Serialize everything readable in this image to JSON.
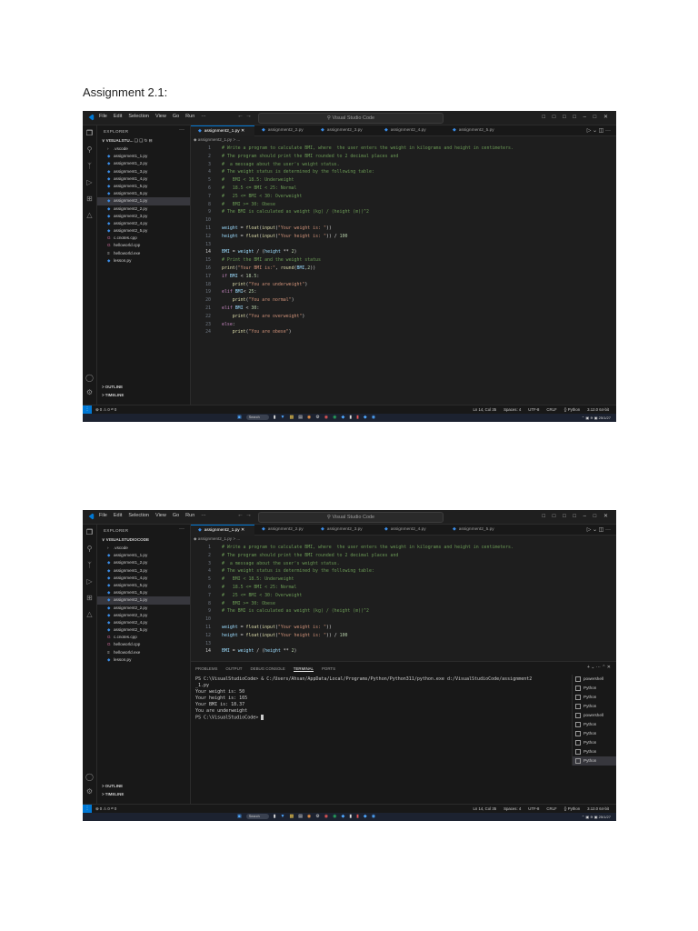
{
  "document": {
    "heading": "Assignment 2.1:"
  },
  "app": {
    "menu": [
      "File",
      "Edit",
      "Selection",
      "View",
      "Go",
      "Run",
      "···"
    ],
    "search": "Visual Studio Code",
    "window_controls": "□ □ □ □   – □ ✕"
  },
  "screens": [
    {
      "explorer_header": "EXPLORER",
      "explorer_root": "∨ VISUALSTU...",
      "files": [
        ".vscode",
        "assignment1_1.py",
        "assignment1_2.py",
        "assignment1_3.py",
        "assignment1_4.py",
        "assignment1_5.py",
        "assignment1_6.py",
        "assignment2_1.py",
        "assignment2_2.py",
        "assignment2_3.py",
        "assignment2_4.py",
        "assignment2_5.py",
        "c.cnotes.cpp",
        "helloworld.cpp",
        "helloworld.exe",
        "lesson.py"
      ],
      "active_file_index": 7,
      "outline": "> OUTLINE",
      "timeline": "> TIMELINE",
      "tabs": [
        "assignment2_1.py ✕",
        "assignment2_2.py",
        "assignment2_3.py",
        "assignment2_4.py",
        "assignment2_5.py"
      ],
      "breadcrumb": "◆ assignment2_1.py > ...",
      "status_left": "⊗ 0 ⚠ 0   ᵂ 0",
      "status_right": [
        "Ln 14, Col 35",
        "Spaces: 4",
        "UTF-8",
        "CRLF",
        "{} Python",
        "3.12.0 64-bit"
      ],
      "taskbar_search": "Search",
      "taskbar_time": "25/1/27"
    },
    {
      "explorer_header": "EXPLORER",
      "explorer_root": "∨ VISUALSTUDIOCODE",
      "files": [
        ".vscode",
        "assignment1_1.py",
        "assignment1_2.py",
        "assignment1_3.py",
        "assignment1_4.py",
        "assignment1_5.py",
        "assignment1_6.py",
        "assignment2_1.py",
        "assignment2_2.py",
        "assignment2_3.py",
        "assignment2_4.py",
        "assignment2_5.py",
        "c.cnotes.cpp",
        "helloworld.cpp",
        "helloworld.exe",
        "lesson.py"
      ],
      "active_file_index": 7,
      "outline": "> OUTLINE",
      "timeline": "> TIMELINE",
      "tabs": [
        "assignment2_1.py ✕",
        "assignment2_2.py",
        "assignment2_3.py",
        "assignment2_4.py",
        "assignment2_5.py"
      ],
      "breadcrumb": "◆ assignment2_1.py > ...",
      "panel_tabs": [
        "PROBLEMS",
        "OUTPUT",
        "DEBUG CONSOLE",
        "TERMINAL",
        "PORTS"
      ],
      "terminal": [
        "PS C:\\VisualStudioCode> & C:/Users/Ahsan/AppData/Local/Programs/Python/Python311/python.exe d:/VisualStudioCode/assignment2",
        "_1.py",
        "Your weight is: 50",
        "Your height is: 165",
        "Your BMI is: 18.37",
        "You are underweight",
        "PS C:\\VisualStudioCode> "
      ],
      "terminal_list": [
        "powershell",
        "Python",
        "Python",
        "Python",
        "powershell",
        "Python",
        "Python",
        "Python",
        "Python",
        "Python"
      ],
      "status_left": "⊗ 0 ⚠ 0   ᵂ 0",
      "status_right": [
        "Ln 14, Col 35",
        "Spaces: 4",
        "UTF-8",
        "CRLF",
        "{} Python",
        "3.12.0 64-bit"
      ],
      "taskbar_search": "Search",
      "taskbar_time": "25/1/27"
    }
  ],
  "code_lines": [
    "# Write a program to calculate BMI, where  the user enters the weight in kilograms and height in centimeters.",
    "# The program should print the BMI rounded to 2 decimal places and",
    "#  a message about the user's weight status.",
    "# The weight status is determined by the following table:",
    "#   BMI < 18.5: Underweight",
    "#   18.5 <= BMI < 25: Normal",
    "#   25 <= BMI < 30: Overweight",
    "#   BMI >= 30: Obese",
    "# The BMI is calculated as weight (kg) / (height (m))^2",
    "",
    "weight = float(input(\"Your weight is: \"))",
    "height = float(input(\"Your height is: \")) / 100",
    "",
    "BMI = weight / (height ** 2)",
    "# Print the BMI and the weight status",
    "print(\"Your BMI is:\", round(BMI,2))",
    "if BMI < 18.5:",
    "    print(\"You are underweight\")",
    "elif BMI< 25:",
    "    print(\"You are normal\")",
    "elif BMI < 30:",
    "    print(\"You are overweight\")",
    "else:",
    "    print(\"You are obese\")"
  ],
  "colors": {
    "editor_bg": "#1e1e1e",
    "comment": "#6a9955",
    "string": "#ce9178",
    "variable": "#9cdcfe",
    "function": "#dcdcaa",
    "keyword": "#c586c0",
    "accent": "#0078d4"
  }
}
